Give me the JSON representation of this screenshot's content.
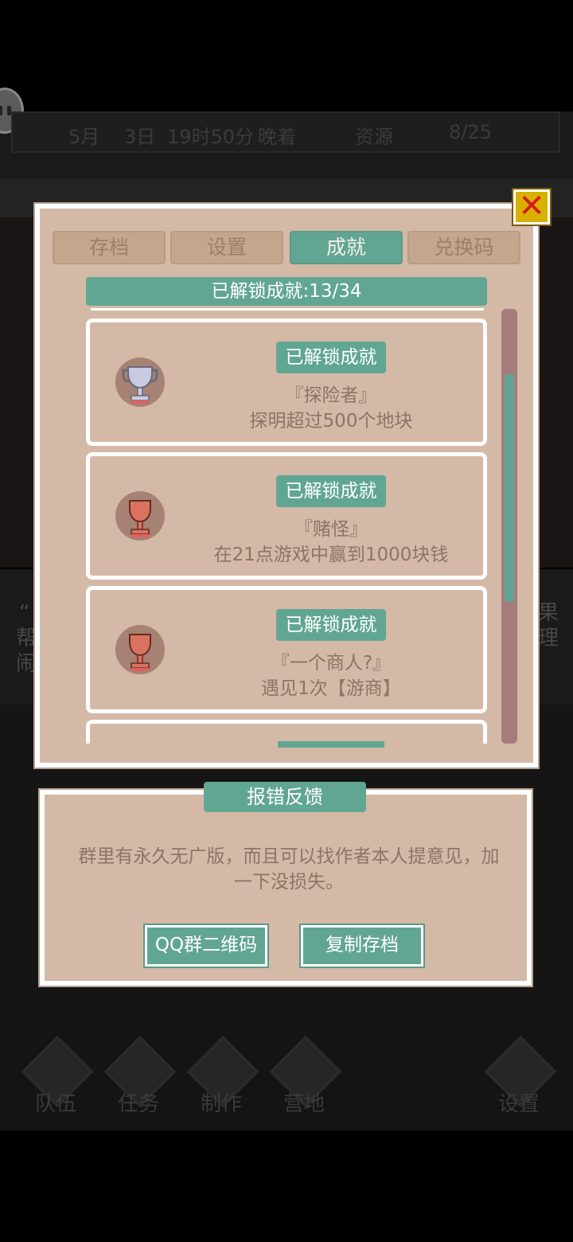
{
  "background": {
    "status_bar": [
      "5月",
      "3日",
      "19时50分",
      "晚着",
      "资源",
      "8/25"
    ],
    "story_lines": [
      "“",
      "帮",
      "闹"
    ],
    "story_right": [
      "果",
      "理"
    ]
  },
  "bottom_nav": [
    {
      "label": "队伍"
    },
    {
      "label": "任务"
    },
    {
      "label": "制作"
    },
    {
      "label": "营地"
    },
    {
      "label": "设置"
    }
  ],
  "achievements_panel": {
    "tabs": [
      {
        "label": "存档",
        "active": false
      },
      {
        "label": "设置",
        "active": false
      },
      {
        "label": "成就",
        "active": true
      },
      {
        "label": "兑换码",
        "active": false
      }
    ],
    "unlocked_count": "已解锁成就:13/34",
    "items": [
      {
        "badge": "已解锁成就",
        "name": "『探险者』",
        "description": "探明超过500个地块",
        "trophy": "silver-trophy-icon"
      },
      {
        "badge": "已解锁成就",
        "name": "『赌怪』",
        "description": "在21点游戏中赢到1000块钱",
        "trophy": "bronze-trophy-icon"
      },
      {
        "badge": "已解锁成就",
        "name": "『一个商人?』",
        "description": "遇见1次【游商】",
        "trophy": "bronze-trophy-icon"
      }
    ],
    "close_label": "✕"
  },
  "feedback_panel": {
    "title": "报错反馈",
    "message_line1": "群里有永久无广版，而且可以找作者本人提意见，加",
    "message_line2": "一下没损失。",
    "qq_button": "QQ群二维码",
    "copy_button": "复制存档"
  },
  "colors": {
    "panel": "#d3b9a6",
    "accent": "#61a693",
    "text": "#8e7462",
    "close": "#d8b000"
  }
}
